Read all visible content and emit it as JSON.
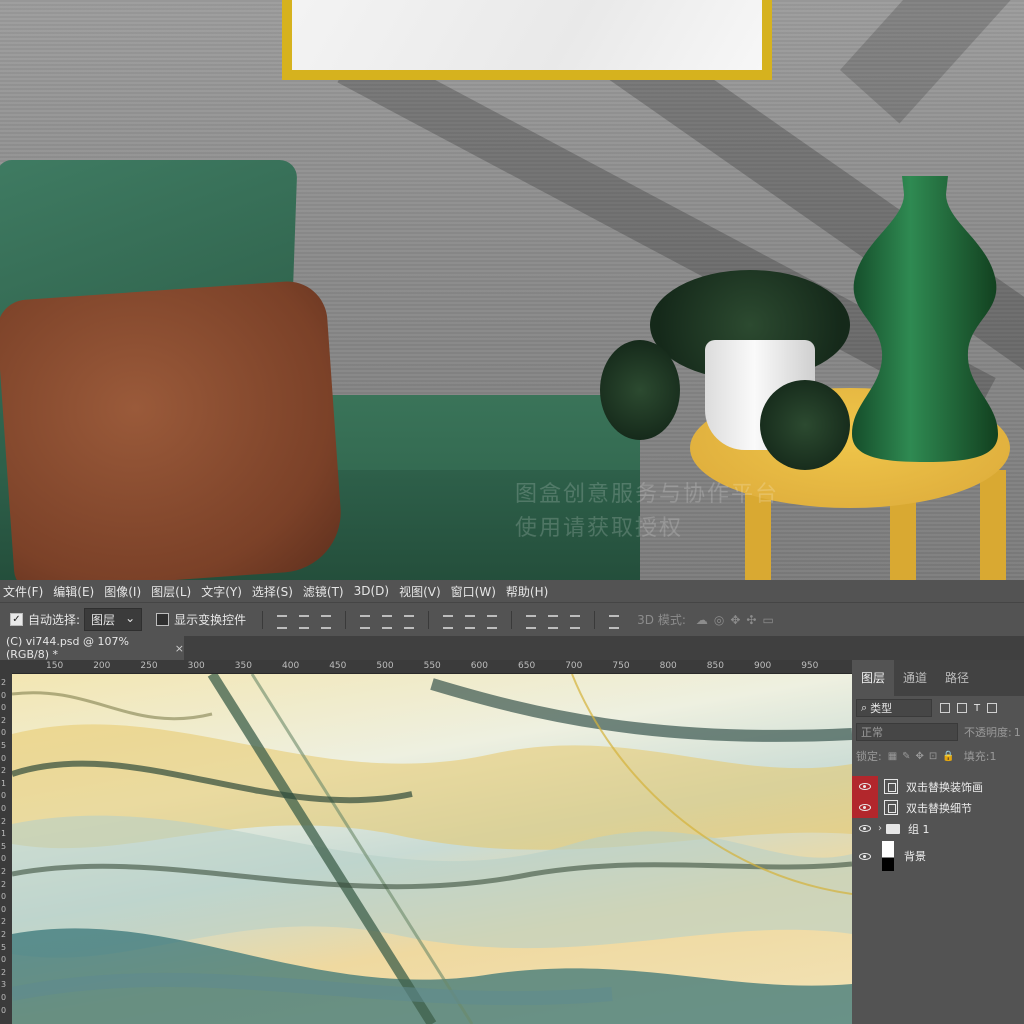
{
  "menu": [
    "文件(F)",
    "编辑(E)",
    "图像(I)",
    "图层(L)",
    "文字(Y)",
    "选择(S)",
    "滤镜(T)",
    "3D(D)",
    "视图(V)",
    "窗口(W)",
    "帮助(H)"
  ],
  "options": {
    "auto_select_label": "自动选择:",
    "auto_select_checked": true,
    "auto_select_target": "图层",
    "show_transform_label": "显示变换控件",
    "mode_3d_label": "3D 模式:"
  },
  "document": {
    "tab_title": "(C) vi744.psd @ 107%(RGB/8) *",
    "close_glyph": "×"
  },
  "ruler": {
    "h_ticks": [
      "150",
      "200",
      "250",
      "300",
      "350",
      "400",
      "450",
      "500",
      "550",
      "600",
      "650",
      "700",
      "750",
      "800",
      "850",
      "900",
      "950"
    ],
    "v_ticks": [
      "2",
      "0",
      "0",
      "2",
      "0",
      "5",
      "0",
      "2",
      "1",
      "0",
      "0",
      "2",
      "1",
      "5",
      "0",
      "2",
      "2",
      "0",
      "0",
      "2",
      "2",
      "5",
      "0",
      "2",
      "3",
      "0",
      "0"
    ]
  },
  "watermark": {
    "line1": "图盒创意服务与协作平台",
    "line2": "使用请获取授权"
  },
  "layers_panel": {
    "tabs": [
      "图层",
      "通道",
      "路径"
    ],
    "active_tab": 0,
    "filter_kind": "类型",
    "blend_mode": "正常",
    "opacity_label": "不透明度:",
    "opacity_value": "1",
    "lock_label": "锁定:",
    "fill_label": "填充:",
    "fill_value": "1",
    "layers": [
      {
        "name": "双击替换装饰画",
        "kind": "smart-object",
        "highlight": true
      },
      {
        "name": "双击替换细节",
        "kind": "smart-object",
        "highlight": true
      },
      {
        "name": "组 1",
        "kind": "group",
        "highlight": false
      },
      {
        "name": "背景",
        "kind": "background",
        "highlight": false
      }
    ]
  },
  "colors": {
    "chrome": "#535353",
    "panel_dark": "#424242",
    "visibility_highlight": "#b2272c",
    "frame_gold": "#d6b21e",
    "chair_green": "#2d5f49",
    "pillow_brown": "#7b4128",
    "table_yellow": "#e3b23c",
    "vase_green": "#1f6b3a"
  }
}
